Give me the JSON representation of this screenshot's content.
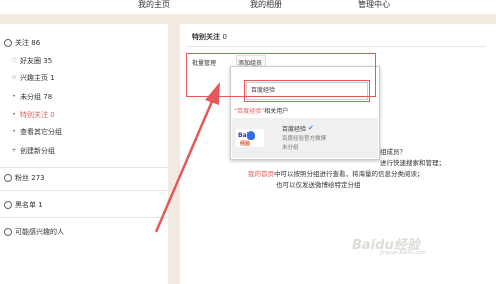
{
  "nav": {
    "home": "我的主页",
    "album": "我的相册",
    "manage": "管理中心"
  },
  "sidebar": {
    "follow": {
      "label": "关注",
      "count": "86"
    },
    "items": [
      {
        "icon": "heart-icon",
        "label": "好友圈",
        "count": "35"
      },
      {
        "icon": "star-icon",
        "label": "兴趣主页",
        "count": "1"
      },
      {
        "icon": "dot-icon",
        "label": "未分组",
        "count": "78"
      },
      {
        "icon": "dot-icon",
        "label": "特别关注",
        "count": "0"
      },
      {
        "icon": "dot-icon",
        "label": "查看其它分组",
        "count": ""
      },
      {
        "icon": "plus-icon",
        "label": "创建新分组",
        "count": ""
      }
    ],
    "fans": {
      "label": "粉丝",
      "count": "273"
    },
    "blacklist": {
      "label": "黑名单",
      "count": "1"
    },
    "interest": {
      "label": "可能感兴趣的人"
    }
  },
  "main": {
    "title": "特别关注",
    "title_count": "0",
    "batch_manage": "批量管理",
    "add_member": "添加组员"
  },
  "dropdown": {
    "search_value": "百度经验",
    "suggest_prefix": "“百度经验”",
    "suggest_suffix": "相关用户",
    "result": {
      "logo_text_a": "Bai",
      "logo_text_b": "经验",
      "name": "百度经验",
      "desc": "百度经验官方微博",
      "group": "未分组"
    }
  },
  "info": {
    "l1_tail": "组成员？",
    "l2_tail": "进行快速搜索和管理；",
    "l3_link": "我的首页",
    "l3_text": "中可以按照分组进行查看，将海量的信息分类阅读；",
    "l4": "也可以仅发送微博给特定分组"
  },
  "watermark": {
    "main": "Baidu经验",
    "sub": "jingyan.baidu.com"
  },
  "colors": {
    "highlight": "#e25a5a",
    "background": "#f3ebe2",
    "verify": "#3a8ee6"
  }
}
